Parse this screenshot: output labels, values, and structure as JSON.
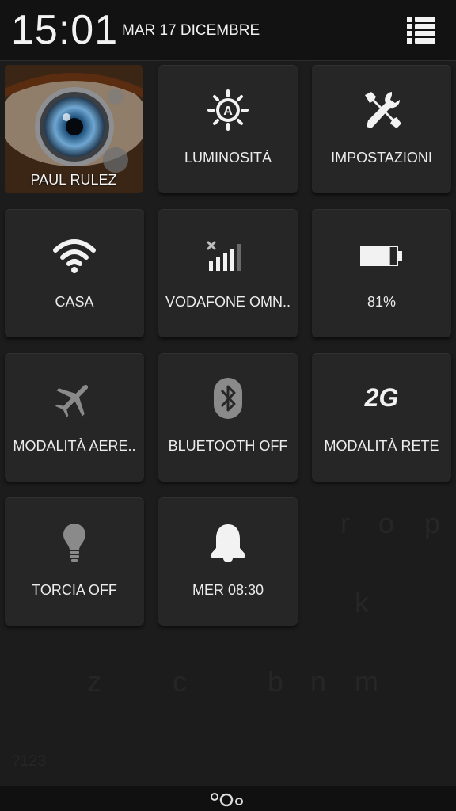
{
  "status": {
    "time": "15:01",
    "date": "MAR 17 DICEMBRE",
    "menu_icon": "list-icon"
  },
  "profile": {
    "name": "PAUL RULEZ"
  },
  "tiles": {
    "brightness": {
      "label": "LUMINOSITÀ",
      "icon": "brightness-auto-icon"
    },
    "settings": {
      "label": "IMPOSTAZIONI",
      "icon": "tools-icon"
    },
    "wifi": {
      "label": "CASA",
      "icon": "wifi-icon"
    },
    "mobile": {
      "label": "VODAFONE OMN..",
      "icon": "signal-no-data-icon"
    },
    "battery": {
      "label": "81%",
      "icon": "battery-icon",
      "level": 0.81
    },
    "airplane": {
      "label": "MODALITÀ AERE..",
      "icon": "airplane-icon"
    },
    "bluetooth": {
      "label": "BLUETOOTH OFF",
      "icon": "bluetooth-icon"
    },
    "network_mode": {
      "label": "MODALITÀ RETE",
      "icon_text": "2G",
      "icon": "network-2g-icon"
    },
    "torch": {
      "label": "TORCIA OFF",
      "icon": "lightbulb-icon"
    },
    "alarm": {
      "label": "MER 08:30",
      "icon": "bell-icon"
    }
  },
  "colors": {
    "background": "#1c1c1c",
    "tile": "#262626",
    "text": "#ececec",
    "icon_active": "#f2f2f2",
    "icon_inactive": "#8a8a8a"
  }
}
